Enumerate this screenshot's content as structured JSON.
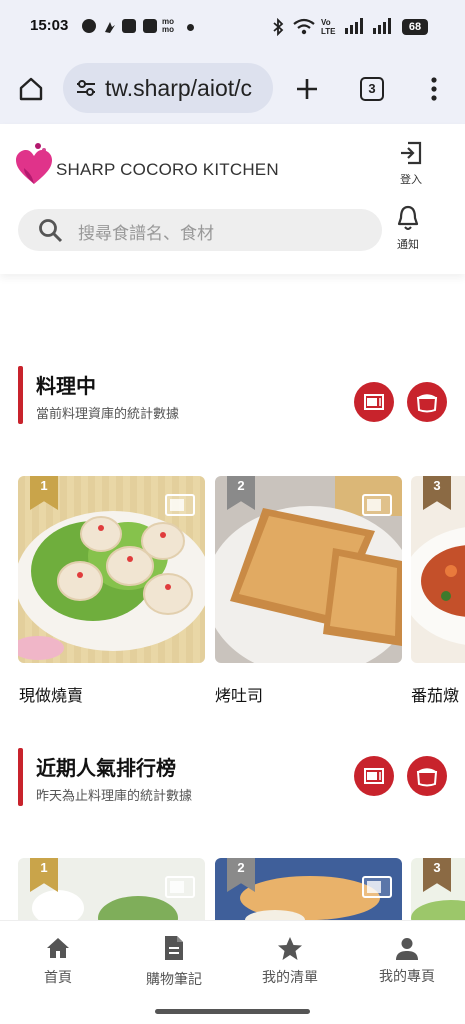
{
  "status": {
    "time": "15:03",
    "battery": "68"
  },
  "browser": {
    "url": "tw.sharp/aiot/c",
    "tab_count": "3"
  },
  "header": {
    "brand": "SHARP COCORO KITCHEN",
    "login_label": "登入",
    "notify_label": "通知",
    "search_placeholder": "搜尋食譜名、食材"
  },
  "sections": [
    {
      "title": "料理中",
      "subtitle": "當前料理資庫的統計數據",
      "cards": [
        {
          "rank": "1",
          "name": "現做燒賣"
        },
        {
          "rank": "2",
          "name": "烤吐司"
        },
        {
          "rank": "3",
          "name": "番茄燉"
        }
      ]
    },
    {
      "title": "近期人氣排行榜",
      "subtitle": "昨天為止料理庫的統計數據",
      "cards": [
        {
          "rank": "1"
        },
        {
          "rank": "2"
        },
        {
          "rank": "3"
        }
      ]
    }
  ],
  "nav": {
    "home": "首頁",
    "shopping_notes": "購物筆記",
    "my_list": "我的清單",
    "my_page": "我的專頁"
  },
  "colors": {
    "accent": "#c8232c",
    "gold": "#c9a44a",
    "silver": "#8a8a8a",
    "bronze": "#8b6a44"
  }
}
